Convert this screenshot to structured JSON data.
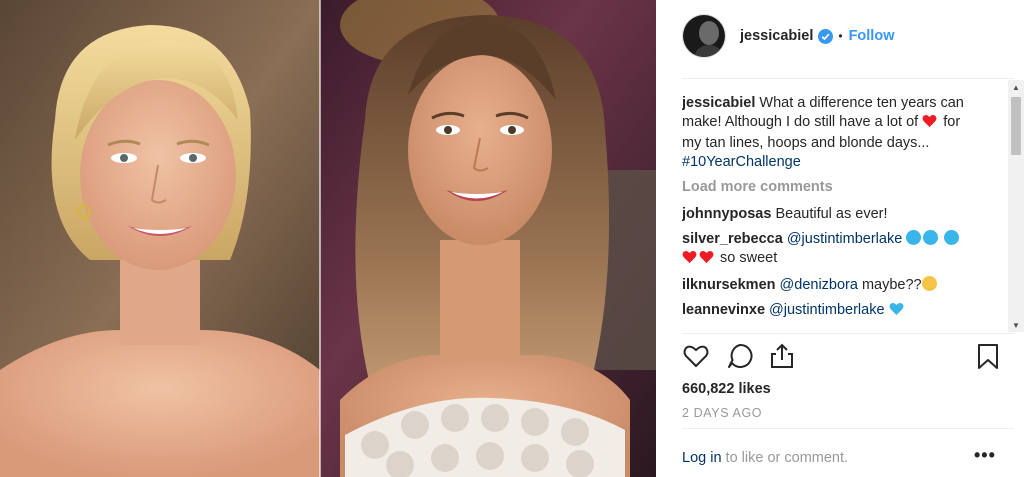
{
  "post": {
    "username": "jessicabiel",
    "follow_label": "Follow",
    "dot": "•",
    "caption_user": "jessicabiel",
    "caption_text_1": "What a difference ten years can make! Although I do still have a lot of",
    "caption_text_2": "for my tan lines, hoops and blonde days...",
    "caption_hashtag": "#10YearChallenge",
    "load_more": "Load more comments",
    "comments": [
      {
        "user": "johnnyposas",
        "text": "Beautiful as ever!"
      },
      {
        "user": "silver_rebecca",
        "mention": "@justintimberlake",
        "text": "so sweet"
      },
      {
        "user": "ilknursekmen",
        "mention": "@denizbora",
        "text": "maybe??"
      },
      {
        "user": "leannevinxe",
        "mention": "@justintimberlake",
        "text": ""
      }
    ],
    "likes": "660,822 likes",
    "time_ago": "2 DAYS AGO",
    "login_link": "Log in",
    "login_text": "to like or comment.",
    "more_icon": "•••"
  },
  "icons": {
    "like": "heart-outline-icon",
    "comment": "speech-bubble-icon",
    "share": "share-icon",
    "save": "bookmark-icon",
    "verified": "verified-badge-icon"
  },
  "colors": {
    "link_blue": "#3897f0",
    "hashtag_blue": "#003569",
    "muted_gray": "#999999",
    "heart_red": "#ed1c24",
    "emoji_blue": "#39b5e9"
  }
}
